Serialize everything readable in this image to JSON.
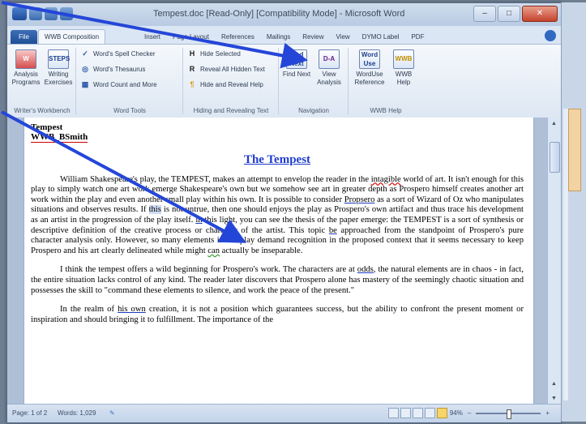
{
  "window": {
    "title": "Tempest.doc [Read-Only] [Compatibility Mode] - Microsoft Word"
  },
  "tabs": [
    {
      "label": "File"
    },
    {
      "label": "WWB Composition"
    },
    {
      "label": "Insert"
    },
    {
      "label": "Page Layout"
    },
    {
      "label": "References"
    },
    {
      "label": "Mailings"
    },
    {
      "label": "Review"
    },
    {
      "label": "View"
    },
    {
      "label": "DYMO Label"
    },
    {
      "label": "PDF"
    }
  ],
  "ribbon": {
    "writers_workbench": {
      "analysis": "Analysis Programs",
      "writing": "Writing Exercises",
      "group": "Writer's Workbench"
    },
    "word_tools": {
      "spell": "Word's Spell Checker",
      "thesaurus": "Word's Thesaurus",
      "count": "Word Count and More",
      "group": "Word Tools"
    },
    "hiding": {
      "hide": "Hide Selected",
      "reveal": "Reveal All Hidden Text",
      "hide_reveal": "Hide and Reveal Help",
      "group": "Hiding and Revealing Text"
    },
    "navigation": {
      "find": "Find Next",
      "view": "View Analysis",
      "group": "Navigation"
    },
    "wwb_help": {
      "worduse": "WordUse Reference",
      "wwb": "WWB Help",
      "group": "WWB Help"
    }
  },
  "document": {
    "header_line1": "Tempest",
    "header_line2": "WWB_BSmith",
    "title": "The Tempest",
    "p1a": "William Shakespeare's play, the TEMPEST, makes an attempt to envelop the reader in the ",
    "p1_intagible": "intagible",
    "p1b": " world of art.  It isn't enough for this play to simply watch one art work emerge Shakespeare's own but we somehow see art in greater depth as Prospero himself creates another art work within the play and even another small play within his own.  It is possible to consider ",
    "p1_propsero": "Propsero",
    "p1c": " as a sort of Wizard of Oz who manipulates situations and observes results.  If ",
    "p1_this": "this",
    "p1d": " is not untrue, then one should enjoys the play as Prospero's own artifact and thus trace his development as an artist in the progression of the play itself.  ",
    "p1_in": "in",
    "p1e": " this light, you can see the thesis of the paper emerge: the TEMPEST is a sort of synthesis or descriptive definition of the creative process or character of the artist.  This topic ",
    "p1_be": "be",
    "p1f": " approached from the standpoint of Prospero's pure character analysis only.  However, so many elements in the play demand recognition in the proposed context that it seems necessary to keep Prospero and his art clearly delineated while might ",
    "p1_can": "can",
    "p1g": " actually be inseparable.",
    "p2a": "I think the tempest offers a wild beginning for Prospero's work.  The characters are at ",
    "p2_odds": "odds",
    "p2b": ", the natural elements are in chaos - in fact, the entire situation lacks control of any kind.  The reader later discovers that Prospero alone has mastery of the seemingly chaotic situation and possesses the skill to \"command these elements to silence, and work the peace of the present.\"",
    "p3a": "In the realm of ",
    "p3_hisown": "his own",
    "p3b": " creation, it is not a position which guarantees success, but the ability to confront the present moment or inspiration and should bringing it to fulfillment.  The importance of the"
  },
  "status": {
    "page": "Page: 1 of 2",
    "words": "Words: 1,029",
    "zoom": "94%"
  },
  "colors": {
    "accent": "#2b5aa8",
    "arrow": "#2446d8",
    "title_blue": "#1f3bcd"
  }
}
